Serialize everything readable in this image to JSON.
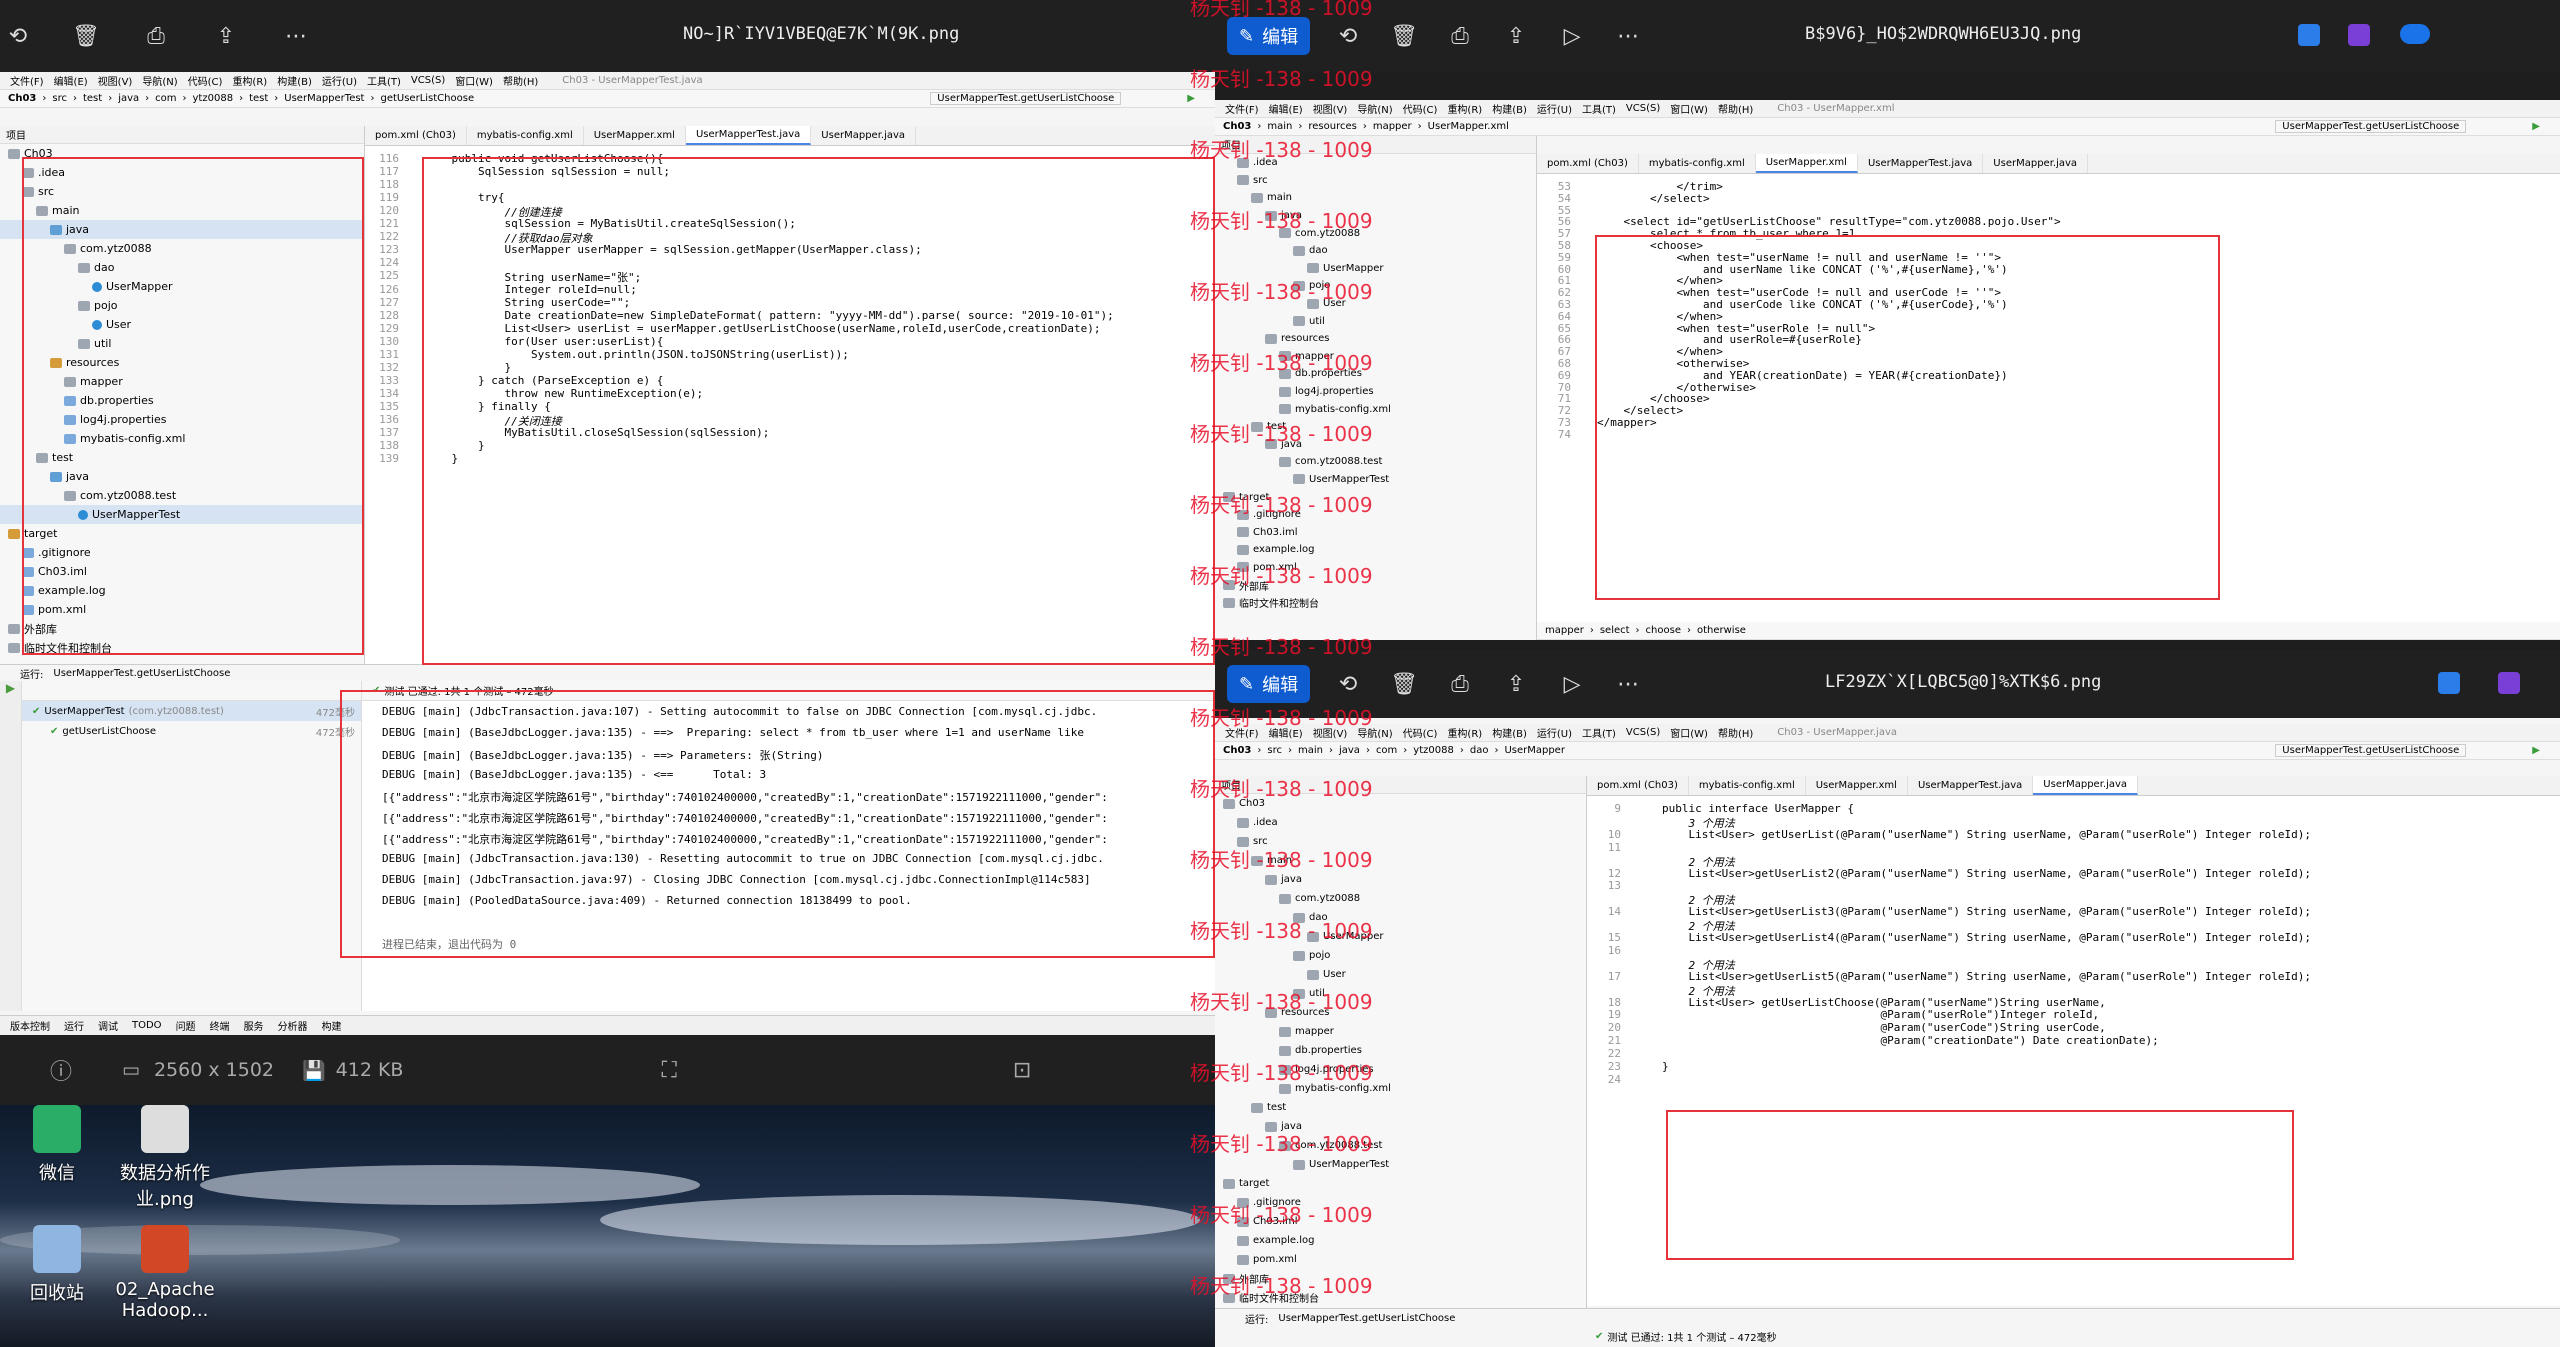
{
  "win1": {
    "title": "NO~]R`IYV1VBEQ@E7K`M(9K.png",
    "ide_title": "Ch03 - UserMapperTest.java",
    "menu": [
      "文件(F)",
      "编辑(E)",
      "视图(V)",
      "导航(N)",
      "代码(C)",
      "重构(R)",
      "构建(B)",
      "运行(U)",
      "工具(T)",
      "VCS(S)",
      "窗口(W)",
      "帮助(H)"
    ],
    "crumbs": [
      "Ch03",
      "src",
      "test",
      "java",
      "com",
      "ytz0088",
      "test",
      "UserMapperTest",
      "getUserListChoose"
    ],
    "run_config": "UserMapperTest.getUserListChoose",
    "project_label": "项目",
    "tree": [
      {
        "label": "Ch03",
        "icon": "folder"
      },
      {
        "label": ".idea",
        "icon": "folder"
      },
      {
        "label": "src",
        "icon": "folder"
      },
      {
        "label": "main",
        "icon": "folder"
      },
      {
        "label": "java",
        "icon": "jfolder",
        "sel": true
      },
      {
        "label": "com.ytz0088",
        "icon": "folder"
      },
      {
        "label": "dao",
        "icon": "folder"
      },
      {
        "label": "UserMapper",
        "icon": "cls"
      },
      {
        "label": "pojo",
        "icon": "folder"
      },
      {
        "label": "User",
        "icon": "cls"
      },
      {
        "label": "util",
        "icon": "folder"
      },
      {
        "label": "resources",
        "icon": "rfolder"
      },
      {
        "label": "mapper",
        "icon": "folder"
      },
      {
        "label": "db.properties",
        "icon": "file"
      },
      {
        "label": "log4j.properties",
        "icon": "file"
      },
      {
        "label": "mybatis-config.xml",
        "icon": "file"
      },
      {
        "label": "test",
        "icon": "folder"
      },
      {
        "label": "java",
        "icon": "jfolder"
      },
      {
        "label": "com.ytz0088.test",
        "icon": "folder"
      },
      {
        "label": "UserMapperTest",
        "icon": "cls",
        "sel": true
      },
      {
        "label": "target",
        "icon": "rfolder"
      },
      {
        "label": ".gitignore",
        "icon": "file"
      },
      {
        "label": "Ch03.iml",
        "icon": "file"
      },
      {
        "label": "example.log",
        "icon": "file"
      },
      {
        "label": "pom.xml",
        "icon": "file"
      },
      {
        "label": "外部库",
        "icon": "folder"
      },
      {
        "label": "临时文件和控制台",
        "icon": "folder"
      }
    ],
    "tabs": [
      "pom.xml (Ch03)",
      "mybatis-config.xml",
      "UserMapper.xml",
      "UserMapperTest.java",
      "UserMapper.java"
    ],
    "active_tab": 3,
    "code": [
      {
        "n": "116",
        "t": "    public void getUserListChoose(){"
      },
      {
        "n": "117",
        "t": "        SqlSession sqlSession = null;"
      },
      {
        "n": "118",
        "t": ""
      },
      {
        "n": "119",
        "t": "        try{"
      },
      {
        "n": "120",
        "t": "            //创建连接"
      },
      {
        "n": "121",
        "t": "            sqlSession = MyBatisUtil.createSqlSession();"
      },
      {
        "n": "122",
        "t": "            //获取dao层对象"
      },
      {
        "n": "123",
        "t": "            UserMapper userMapper = sqlSession.getMapper(UserMapper.class);"
      },
      {
        "n": "124",
        "t": ""
      },
      {
        "n": "125",
        "t": "            String userName=\"张\";"
      },
      {
        "n": "126",
        "t": "            Integer roleId=null;"
      },
      {
        "n": "127",
        "t": "            String userCode=\"\";"
      },
      {
        "n": "128",
        "t": "            Date creationDate=new SimpleDateFormat( pattern: \"yyyy-MM-dd\").parse( source: \"2019-10-01\");"
      },
      {
        "n": "129",
        "t": "            List<User> userList = userMapper.getUserListChoose(userName,roleId,userCode,creationDate);"
      },
      {
        "n": "130",
        "t": "            for(User user:userList){"
      },
      {
        "n": "131",
        "t": "                System.out.println(JSON.toJSONString(userList));"
      },
      {
        "n": "132",
        "t": "            }"
      },
      {
        "n": "133",
        "t": "        } catch (ParseException e) {"
      },
      {
        "n": "134",
        "t": "            throw new RuntimeException(e);"
      },
      {
        "n": "135",
        "t": "        } finally {"
      },
      {
        "n": "136",
        "t": "            //关闭连接"
      },
      {
        "n": "137",
        "t": "            MyBatisUtil.closeSqlSession(sqlSession);"
      },
      {
        "n": "138",
        "t": "        }"
      },
      {
        "n": "139",
        "t": "    }"
      }
    ],
    "run_label": "运行:",
    "run_tab": "UserMapperTest.getUserListChoose",
    "test_status": "测试 已通过: 1共 1 个测试 – 472毫秒",
    "test_tree": [
      {
        "label": "UserMapperTest",
        "sub": "(com.ytz0088.test)",
        "time": "472毫秒"
      },
      {
        "label": "getUserListChoose",
        "sub": "",
        "time": "472毫秒"
      }
    ],
    "console": [
      "DEBUG [main] (JdbcTransaction.java:107) - Setting autocommit to false on JDBC Connection [com.mysql.cj.jdbc.",
      "DEBUG [main] (BaseJdbcLogger.java:135) - ==>  Preparing: select * from tb_user where 1=1 and userName like",
      "DEBUG [main] (BaseJdbcLogger.java:135) - ==> Parameters: 张(String)",
      "DEBUG [main] (BaseJdbcLogger.java:135) - <==      Total: 3",
      "[{\"address\":\"北京市海淀区学院路61号\",\"birthday\":740102400000,\"createdBy\":1,\"creationDate\":1571922111000,\"gender\":",
      "[{\"address\":\"北京市海淀区学院路61号\",\"birthday\":740102400000,\"createdBy\":1,\"creationDate\":1571922111000,\"gender\":",
      "[{\"address\":\"北京市海淀区学院路61号\",\"birthday\":740102400000,\"createdBy\":1,\"creationDate\":1571922111000,\"gender\":",
      "DEBUG [main] (JdbcTransaction.java:130) - Resetting autocommit to true on JDBC Connection [com.mysql.cj.jdbc.",
      "DEBUG [main] (JdbcTransaction.java:97) - Closing JDBC Connection [com.mysql.cj.jdbc.ConnectionImpl@114c583]",
      "DEBUG [main] (PooledDataSource.java:409) - Returned connection 18138499 to pool.",
      "",
      "进程已结束，退出代码为 0"
    ],
    "status": [
      "版本控制",
      "运行",
      "调试",
      "TODO",
      "问题",
      "终端",
      "服务",
      "分析器",
      "构建"
    ]
  },
  "viewer_bottom": {
    "dims": "2560 x 1502",
    "size": "412 KB"
  },
  "desktop": [
    {
      "label": "微信",
      "color": "#2aae67"
    },
    {
      "label": "数据分析作业.png",
      "color": "#dddddd"
    },
    {
      "label": "回收站",
      "color": "#8fb6e0"
    },
    {
      "label": "02_Apache Hadoop...",
      "color": "#d24726"
    }
  ],
  "win2": {
    "title": "B$9V6}_HO$2WDRQWH6EU3JQ.png",
    "edit_label": "编辑",
    "ide_title": "Ch03 - UserMapper.xml",
    "crumbs": [
      "Ch03",
      "main",
      "resources",
      "mapper",
      "UserMapper.xml"
    ],
    "run_config": "UserMapperTest.getUserListChoose",
    "tabs": [
      "pom.xml (Ch03)",
      "mybatis-config.xml",
      "UserMapper.xml",
      "UserMapperTest.java",
      "UserMapper.java"
    ],
    "active_tab": 2,
    "tree": [
      ".idea",
      "src",
      "main",
      "java",
      "com.ytz0088",
      "dao",
      "UserMapper",
      "pojo",
      "User",
      "util",
      "resources",
      "mapper",
      "db.properties",
      "log4j.properties",
      "mybatis-config.xml",
      "test",
      "java",
      "com.ytz0088.test",
      "UserMapperTest",
      "target",
      ".gitignore",
      "Ch03.iml",
      "example.log",
      "pom.xml",
      "外部库",
      "临时文件和控制台"
    ],
    "code": [
      {
        "n": "53",
        "t": "            </trim>"
      },
      {
        "n": "54",
        "t": "        </select>"
      },
      {
        "n": "55",
        "t": ""
      },
      {
        "n": "56",
        "t": "    <select id=\"getUserListChoose\" resultType=\"com.ytz0088.pojo.User\">"
      },
      {
        "n": "57",
        "t": "        select * from tb_user where 1=1"
      },
      {
        "n": "58",
        "t": "        <choose>"
      },
      {
        "n": "59",
        "t": "            <when test=\"userName != null and userName != ''\">"
      },
      {
        "n": "60",
        "t": "                and userName like CONCAT ('%',#{userName},'%')"
      },
      {
        "n": "61",
        "t": "            </when>"
      },
      {
        "n": "62",
        "t": "            <when test=\"userCode != null and userCode != ''\">"
      },
      {
        "n": "63",
        "t": "                and userCode like CONCAT ('%',#{userCode},'%')"
      },
      {
        "n": "64",
        "t": "            </when>"
      },
      {
        "n": "65",
        "t": "            <when test=\"userRole != null\">"
      },
      {
        "n": "66",
        "t": "                and userRole=#{userRole}"
      },
      {
        "n": "67",
        "t": "            </when>"
      },
      {
        "n": "68",
        "t": "            <otherwise>"
      },
      {
        "n": "69",
        "t": "                and YEAR(creationDate) = YEAR(#{creationDate})"
      },
      {
        "n": "70",
        "t": "            </otherwise>"
      },
      {
        "n": "71",
        "t": "        </choose>"
      },
      {
        "n": "72",
        "t": "    </select>"
      },
      {
        "n": "73",
        "t": "</mapper>"
      },
      {
        "n": "74",
        "t": ""
      }
    ],
    "xml_crumbs": [
      "mapper",
      "select",
      "choose",
      "otherwise"
    ]
  },
  "win3": {
    "title": "LF29ZX`X[LQBC5@0]%XTK$6.png",
    "edit_label": "编辑",
    "ide_title": "Ch03 - UserMapper.java",
    "crumbs": [
      "Ch03",
      "src",
      "main",
      "java",
      "com",
      "ytz0088",
      "dao",
      "UserMapper"
    ],
    "run_config": "UserMapperTest.getUserListChoose",
    "tabs": [
      "pom.xml (Ch03)",
      "mybatis-config.xml",
      "UserMapper.xml",
      "UserMapperTest.java",
      "UserMapper.java"
    ],
    "active_tab": 4,
    "tree": [
      "Ch03",
      ".idea",
      "src",
      "main",
      "java",
      "com.ytz0088",
      "dao",
      "UserMapper",
      "pojo",
      "User",
      "util",
      "resources",
      "mapper",
      "db.properties",
      "log4j.properties",
      "mybatis-config.xml",
      "test",
      "java",
      "com.ytz0088.test",
      "UserMapperTest",
      "target",
      ".gitignore",
      "Ch03.iml",
      "example.log",
      "pom.xml",
      "外部库",
      "临时文件和控制台"
    ],
    "code": [
      {
        "n": "9",
        "t": "public interface UserMapper {"
      },
      {
        "n": "",
        "t": "    3 个用法"
      },
      {
        "n": "10",
        "t": "    List<User> getUserList(@Param(\"userName\") String userName, @Param(\"userRole\") Integer roleId);"
      },
      {
        "n": "11",
        "t": ""
      },
      {
        "n": "",
        "t": "    2 个用法"
      },
      {
        "n": "12",
        "t": "    List<User>getUserList2(@Param(\"userName\") String userName, @Param(\"userRole\") Integer roleId);"
      },
      {
        "n": "13",
        "t": ""
      },
      {
        "n": "",
        "t": "    2 个用法"
      },
      {
        "n": "14",
        "t": "    List<User>getUserList3(@Param(\"userName\") String userName, @Param(\"userRole\") Integer roleId);"
      },
      {
        "n": "",
        "t": "    2 个用法"
      },
      {
        "n": "15",
        "t": "    List<User>getUserList4(@Param(\"userName\") String userName, @Param(\"userRole\") Integer roleId);"
      },
      {
        "n": "16",
        "t": ""
      },
      {
        "n": "",
        "t": "    2 个用法"
      },
      {
        "n": "17",
        "t": "    List<User>getUserList5(@Param(\"userName\") String userName, @Param(\"userRole\") Integer roleId);"
      },
      {
        "n": "",
        "t": "    2 个用法"
      },
      {
        "n": "18",
        "t": "    List<User> getUserListChoose(@Param(\"userName\")String userName,"
      },
      {
        "n": "19",
        "t": "                                 @Param(\"userRole\")Integer roleId,"
      },
      {
        "n": "20",
        "t": "                                 @Param(\"userCode\")String userCode,"
      },
      {
        "n": "21",
        "t": "                                 @Param(\"creationDate\") Date creationDate);"
      },
      {
        "n": "22",
        "t": ""
      },
      {
        "n": "23",
        "t": "}"
      },
      {
        "n": "24",
        "t": ""
      }
    ],
    "run_label": "运行:",
    "run_tab": "UserMapperTest.getUserListChoose",
    "test_status": "测试 已通过: 1共 1 个测试 – 472毫秒"
  },
  "watermark": "杨天钊 -138 - 1009"
}
